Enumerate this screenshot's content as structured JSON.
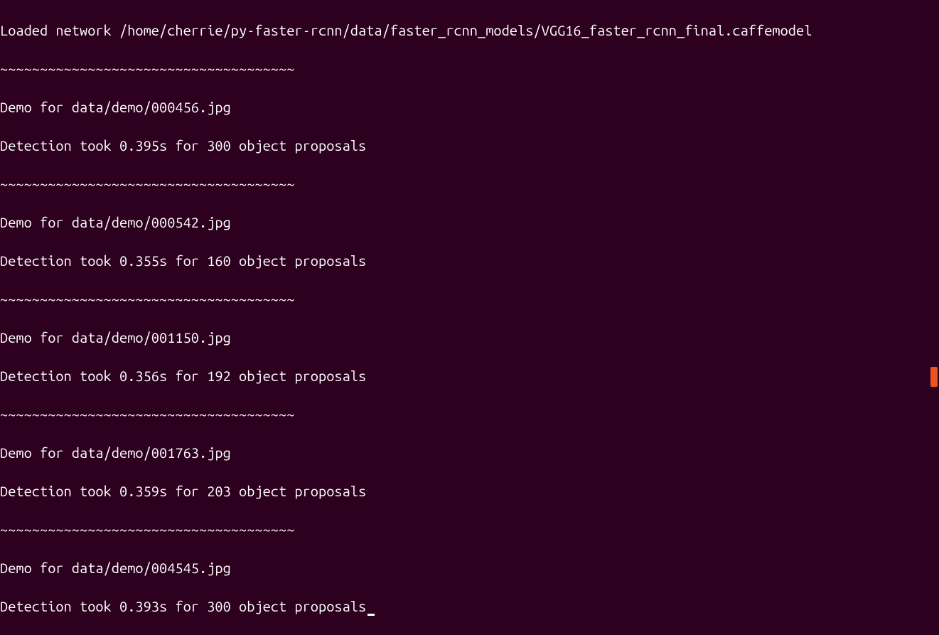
{
  "terminal": {
    "header_line": "Loaded network /home/cherrie/py-faster-rcnn/data/faster_rcnn_models/VGG16_faster_rcnn_final.caffemodel",
    "separator": "~~~~~~~~~~~~~~~~~~~~~~~~~~~~~~~~~~~~~",
    "demos": [
      {
        "demo_line": "Demo for data/demo/000456.jpg",
        "detection_line": "Detection took 0.395s for 300 object proposals"
      },
      {
        "demo_line": "Demo for data/demo/000542.jpg",
        "detection_line": "Detection took 0.355s for 160 object proposals"
      },
      {
        "demo_line": "Demo for data/demo/001150.jpg",
        "detection_line": "Detection took 0.356s for 192 object proposals"
      },
      {
        "demo_line": "Demo for data/demo/001763.jpg",
        "detection_line": "Detection took 0.359s for 203 object proposals"
      },
      {
        "demo_line": "Demo for data/demo/004545.jpg",
        "detection_line": "Detection took 0.393s for 300 object proposals"
      }
    ]
  }
}
